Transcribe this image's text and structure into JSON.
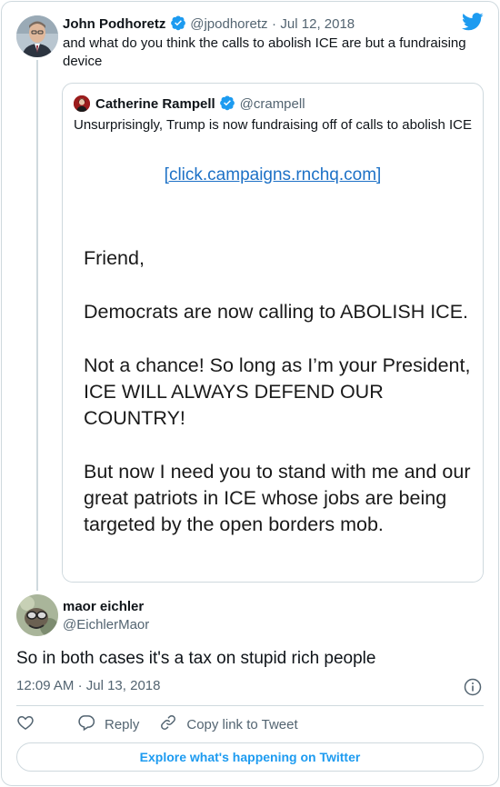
{
  "main_tweet": {
    "author_name": "John Podhoretz",
    "handle": "@jpodhoretz",
    "separator": "·",
    "date": "Jul 12, 2018",
    "text": "and what do you think the calls to abolish ICE are but a fundraising device"
  },
  "quoted_tweet": {
    "author_name": "Catherine Rampell",
    "handle": "@crampell",
    "text": "Unsurprisingly,  Trump is now fundraising off of calls to abolish ICE",
    "image": {
      "link_text": "[click.campaigns.rnchq.com]",
      "paragraphs": [
        "Friend,",
        "Democrats are now calling to ABOLISH ICE.",
        "Not a chance! So long as I’m your President, ICE WILL ALWAYS DEFEND OUR COUNTRY!",
        "But now I need you to stand with me and our great patriots in ICE whose jobs are being targeted by the open borders mob."
      ]
    }
  },
  "reply_tweet": {
    "author_name": "maor eichler",
    "handle": "@EichlerMaor",
    "text": "So in both cases it's a tax on stupid rich people",
    "time": "12:09 AM",
    "separator": "·",
    "date": "Jul 13, 2018"
  },
  "actions": {
    "reply_label": "Reply",
    "copy_link_label": "Copy link to Tweet"
  },
  "footer": {
    "explore_label": "Explore what's happening on Twitter"
  },
  "colors": {
    "twitter_blue": "#1d9bf0",
    "secondary_text": "#536471",
    "border": "#cfd9de"
  },
  "icons": [
    "twitter-bird-icon",
    "verified-badge-icon",
    "info-icon",
    "heart-icon",
    "reply-icon",
    "link-icon"
  ]
}
